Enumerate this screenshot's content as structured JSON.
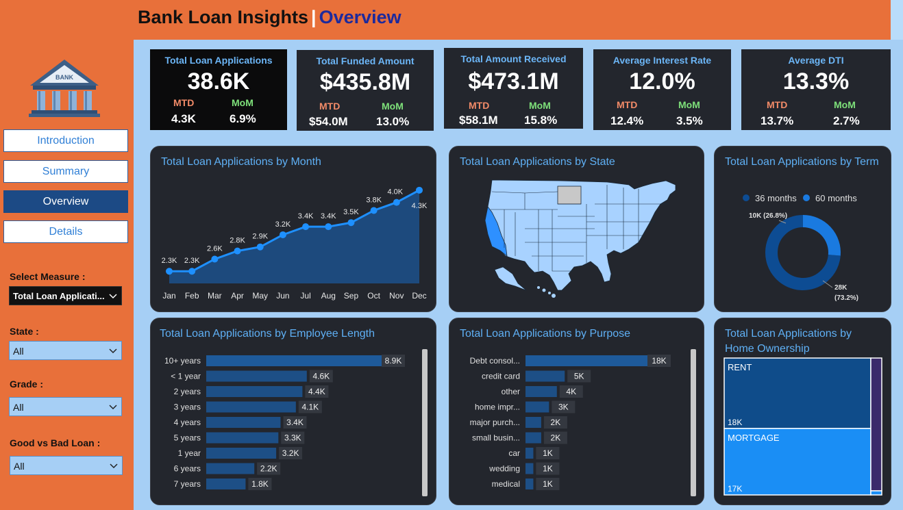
{
  "header": {
    "title": "Bank Loan Insights",
    "separator": "|",
    "subtitle": "Overview"
  },
  "logo": {
    "text": "BANK"
  },
  "nav": [
    {
      "label": "Introduction",
      "active": false
    },
    {
      "label": "Summary",
      "active": false
    },
    {
      "label": "Overview",
      "active": true
    },
    {
      "label": "Details",
      "active": false
    }
  ],
  "filters": {
    "measure": {
      "label": "Select Measure :",
      "value": "Total Loan Applicati..."
    },
    "state": {
      "label": "State :",
      "value": "All"
    },
    "grade": {
      "label": "Grade :",
      "value": "All"
    },
    "good_bad": {
      "label": "Good vs Bad Loan :",
      "value": "All"
    }
  },
  "kpis": [
    {
      "title": "Total Loan Applications",
      "value": "38.6K",
      "mtd_label": "MTD",
      "mtd": "4.3K",
      "mom_label": "MoM",
      "mom": "6.9%"
    },
    {
      "title": "Total Funded Amount",
      "value": "$435.8M",
      "mtd_label": "MTD",
      "mtd": "$54.0M",
      "mom_label": "MoM",
      "mom": "13.0%"
    },
    {
      "title": "Total Amount Received",
      "value": "$473.1M",
      "mtd_label": "MTD",
      "mtd": "$58.1M",
      "mom_label": "MoM",
      "mom": "15.8%"
    },
    {
      "title": "Average Interest Rate",
      "value": "12.0%",
      "mtd_label": "MTD",
      "mtd": "12.4%",
      "mom_label": "MoM",
      "mom": "3.5%"
    },
    {
      "title": "Average DTI",
      "value": "13.3%",
      "mtd_label": "MTD",
      "mtd": "13.7%",
      "mom_label": "MoM",
      "mom": "2.7%"
    }
  ],
  "cards": {
    "month": "Total Loan Applications by Month",
    "state": "Total Loan Applications by State",
    "term": "Total Loan Applications by Term",
    "emp": "Total Loan Applications by Employee Length",
    "purpose": "Total Loan Applications by Purpose",
    "home": "Total Loan Applications by Home Ownership"
  },
  "colors": {
    "accent": "#e8703a",
    "panel": "#23262d",
    "primary": "#1e90ff",
    "dark_blue": "#1c4a85",
    "title_blue": "#5fb0f5"
  },
  "chart_data": [
    {
      "id": "month",
      "type": "area",
      "title": "Total Loan Applications by Month",
      "categories": [
        "Jan",
        "Feb",
        "Mar",
        "Apr",
        "May",
        "Jun",
        "Jul",
        "Aug",
        "Sep",
        "Oct",
        "Nov",
        "Dec"
      ],
      "values": [
        2.3,
        2.3,
        2.6,
        2.8,
        2.9,
        3.2,
        3.4,
        3.4,
        3.5,
        3.8,
        4.0,
        4.3
      ],
      "labels": [
        "2.3K",
        "2.3K",
        "2.6K",
        "2.8K",
        "2.9K",
        "3.2K",
        "3.4K",
        "3.4K",
        "3.5K",
        "3.8K",
        "4.0K",
        "4.3K"
      ],
      "ylim": [
        2.0,
        4.5
      ],
      "color": "#1e90ff"
    },
    {
      "id": "state",
      "type": "map",
      "title": "Total Loan Applications by State"
    },
    {
      "id": "term",
      "type": "pie",
      "title": "Total Loan Applications by Term",
      "legend_position": "top",
      "series": [
        {
          "name": "36 months",
          "value": 28,
          "label": "28K (73.2%)",
          "color": "#0d4c93"
        },
        {
          "name": "60 months",
          "value": 10,
          "label": "10K (26.8%)",
          "color": "#1a7ae0"
        }
      ]
    },
    {
      "id": "emp",
      "type": "bar",
      "title": "Total Loan Applications by Employee Length",
      "categories": [
        "10+ years",
        "< 1 year",
        "2 years",
        "3 years",
        "4 years",
        "5 years",
        "1 year",
        "6 years",
        "7 years"
      ],
      "values": [
        8.9,
        4.6,
        4.4,
        4.1,
        3.4,
        3.3,
        3.2,
        2.2,
        1.8
      ],
      "labels": [
        "8.9K",
        "4.6K",
        "4.4K",
        "4.1K",
        "3.4K",
        "3.3K",
        "3.2K",
        "2.2K",
        "1.8K"
      ],
      "xlim": [
        0,
        8.9
      ]
    },
    {
      "id": "purpose",
      "type": "bar",
      "title": "Total Loan Applications by Purpose",
      "categories": [
        "Debt consol...",
        "credit card",
        "other",
        "home impr...",
        "major purch...",
        "small busin...",
        "car",
        "wedding",
        "medical"
      ],
      "values": [
        18,
        5,
        4,
        3,
        2,
        2,
        1,
        1,
        1
      ],
      "labels": [
        "18K",
        "5K",
        "4K",
        "3K",
        "2K",
        "2K",
        "1K",
        "1K",
        "1K"
      ],
      "xlim": [
        0,
        18
      ]
    },
    {
      "id": "home",
      "type": "treemap",
      "title": "Total Loan Applications by Home Ownership",
      "series": [
        {
          "name": "RENT",
          "value": 18,
          "label": "18K",
          "color": "#0f4c8a"
        },
        {
          "name": "MORTGAGE",
          "value": 17,
          "label": "17K",
          "color": "#1a8ef5"
        },
        {
          "name": "",
          "value": 3,
          "label": "",
          "color": "#3a2a6b"
        }
      ]
    }
  ]
}
